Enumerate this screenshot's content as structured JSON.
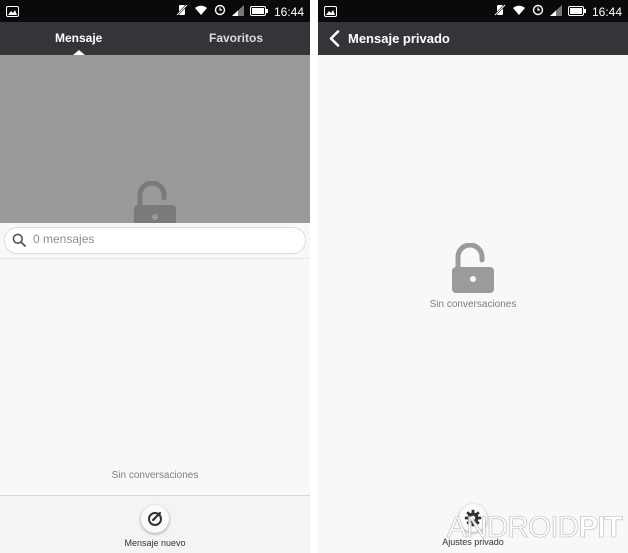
{
  "status_bar": {
    "time": "16:44"
  },
  "left_screen": {
    "tabs": [
      {
        "label": "Mensaje",
        "active": true
      },
      {
        "label": "Favoritos",
        "active": false
      }
    ],
    "search": {
      "placeholder": "0 mensajes"
    },
    "empty_text": "Sin conversaciones",
    "bottom_button": {
      "label": "Mensaje nuevo",
      "icon": "compose-icon"
    }
  },
  "right_screen": {
    "header": {
      "title": "Mensaje privado",
      "back_icon": "chevron-left-icon"
    },
    "empty_text": "Sin conversaciones",
    "bottom_button": {
      "label": "Ajustes privado",
      "icon": "gear-icon"
    }
  },
  "watermark": {
    "text_thin": "ANDROID",
    "text_bold": "PIT"
  },
  "colors": {
    "header": "#333538",
    "status_bar": "#0a0a0a",
    "grey_panel": "#9a9a9a",
    "lock": "#9b9b9b"
  }
}
